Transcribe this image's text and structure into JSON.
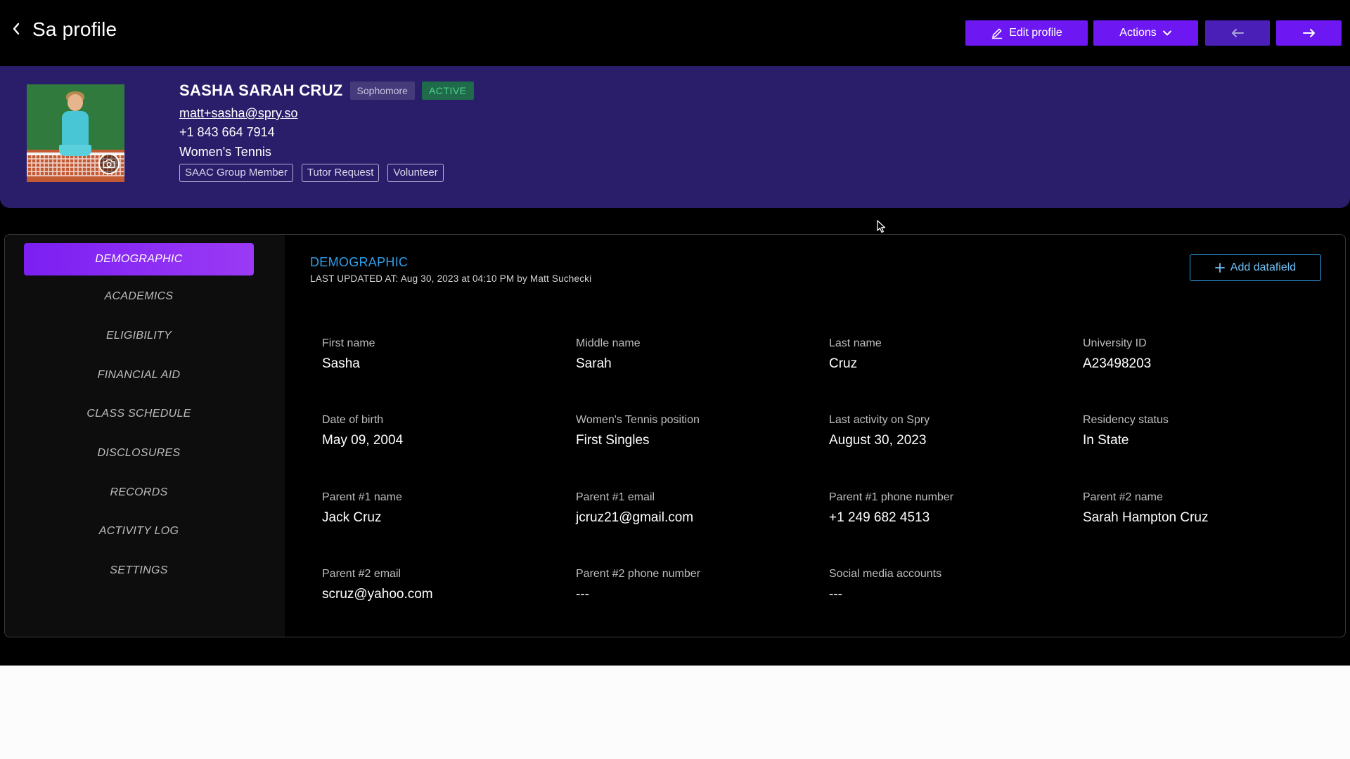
{
  "header": {
    "title": "Sa profile",
    "edit_label": "Edit profile",
    "actions_label": "Actions"
  },
  "profile": {
    "name": "SASHA SARAH CRUZ",
    "year": "Sophomore",
    "status": "ACTIVE",
    "email": "matt+sasha@spry.so",
    "phone": "+1 843 664 7914",
    "sport": "Women's Tennis",
    "tags": [
      "SAAC Group Member",
      "Tutor Request",
      "Volunteer"
    ]
  },
  "sidebar": {
    "items": [
      {
        "label": "DEMOGRAPHIC",
        "active": true
      },
      {
        "label": "ACADEMICS"
      },
      {
        "label": "ELIGIBILITY"
      },
      {
        "label": "FINANCIAL AID"
      },
      {
        "label": "CLASS SCHEDULE"
      },
      {
        "label": "DISCLOSURES"
      },
      {
        "label": "RECORDS"
      },
      {
        "label": "ACTIVITY LOG"
      },
      {
        "label": "SETTINGS"
      }
    ]
  },
  "section": {
    "title": "DEMOGRAPHIC",
    "updated": "LAST UPDATED AT: Aug 30, 2023 at 04:10 PM by Matt Suchecki",
    "add_label": "Add datafield"
  },
  "fields": [
    {
      "label": "First name",
      "value": "Sasha"
    },
    {
      "label": "Middle name",
      "value": "Sarah"
    },
    {
      "label": "Last name",
      "value": "Cruz"
    },
    {
      "label": "University ID",
      "value": "A23498203"
    },
    {
      "label": "Date of birth",
      "value": "May 09, 2004"
    },
    {
      "label": "Women's Tennis position",
      "value": "First Singles"
    },
    {
      "label": "Last activity on Spry",
      "value": "August 30, 2023"
    },
    {
      "label": "Residency status",
      "value": "In State"
    },
    {
      "label": "Parent #1 name",
      "value": "Jack Cruz"
    },
    {
      "label": "Parent #1 email",
      "value": "jcruz21@gmail.com"
    },
    {
      "label": "Parent #1 phone number",
      "value": "+1 249 682 4513"
    },
    {
      "label": "Parent #2 name",
      "value": "Sarah Hampton Cruz"
    },
    {
      "label": "Parent #2 email",
      "value": "scruz@yahoo.com"
    },
    {
      "label": "Parent #2 phone number",
      "value": "---"
    },
    {
      "label": "Social media accounts",
      "value": "---"
    }
  ],
  "colors": {
    "accent": "#6d18f2",
    "banner": "#2a1e6b",
    "link_blue": "#2f9ee8",
    "status_green": "#4fd38e"
  },
  "icons": [
    "chevron-left-icon",
    "pencil-icon",
    "chevron-down-icon",
    "arrow-left-icon",
    "arrow-right-icon",
    "camera-icon",
    "plus-icon",
    "mouse-cursor-icon"
  ]
}
